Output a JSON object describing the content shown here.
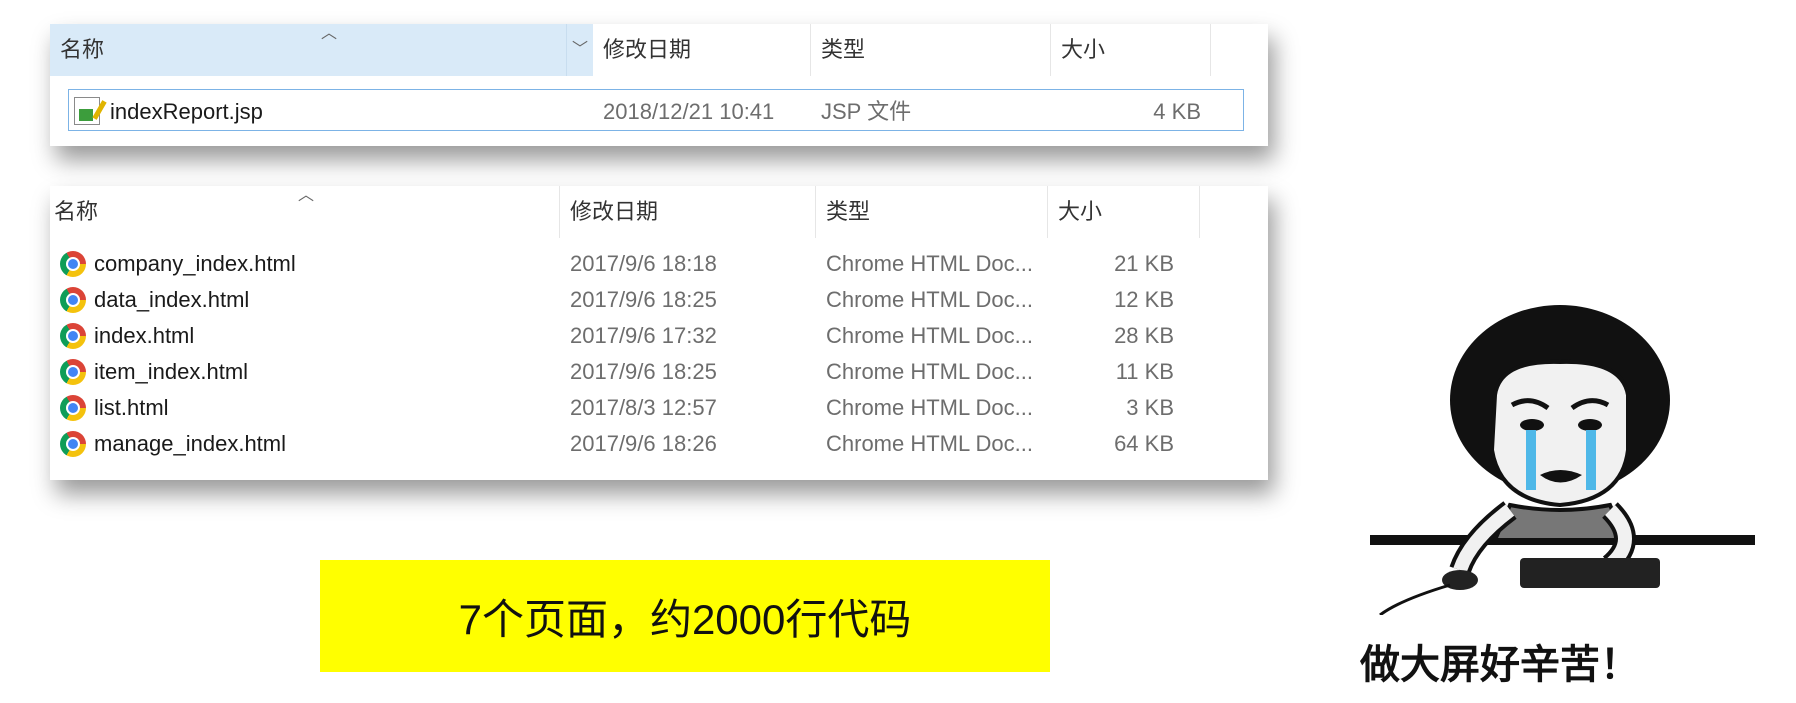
{
  "explorer_top": {
    "columns": {
      "name": "名称",
      "date": "修改日期",
      "type": "类型",
      "size": "大小"
    },
    "files": [
      {
        "name": "indexReport.jsp",
        "date": "2018/12/21 10:41",
        "type": "JSP 文件",
        "size": "4 KB",
        "icon": "jsp-file-icon"
      }
    ]
  },
  "explorer_bottom": {
    "columns": {
      "name": "名称",
      "date": "修改日期",
      "type": "类型",
      "size": "大小"
    },
    "files": [
      {
        "name": "company_index.html",
        "date": "2017/9/6 18:18",
        "type": "Chrome HTML Doc...",
        "size": "21 KB",
        "icon": "chrome-icon"
      },
      {
        "name": "data_index.html",
        "date": "2017/9/6 18:25",
        "type": "Chrome HTML Doc...",
        "size": "12 KB",
        "icon": "chrome-icon"
      },
      {
        "name": "index.html",
        "date": "2017/9/6 17:32",
        "type": "Chrome HTML Doc...",
        "size": "28 KB",
        "icon": "chrome-icon"
      },
      {
        "name": "item_index.html",
        "date": "2017/9/6 18:25",
        "type": "Chrome HTML Doc...",
        "size": "11 KB",
        "icon": "chrome-icon"
      },
      {
        "name": "list.html",
        "date": "2017/8/3 12:57",
        "type": "Chrome HTML Doc...",
        "size": "3 KB",
        "icon": "chrome-icon"
      },
      {
        "name": "manage_index.html",
        "date": "2017/9/6 18:26",
        "type": "Chrome HTML Doc...",
        "size": "64 KB",
        "icon": "chrome-icon"
      }
    ]
  },
  "banner": {
    "text": "7个页面，约2000行代码",
    "color": "#ffff00"
  },
  "meme": {
    "caption": "做大屏好辛苦！",
    "icon": "crying-meme-figure"
  },
  "colors": {
    "selection_border": "#7cb3e6",
    "sorted_header": "#d9eaf8"
  }
}
